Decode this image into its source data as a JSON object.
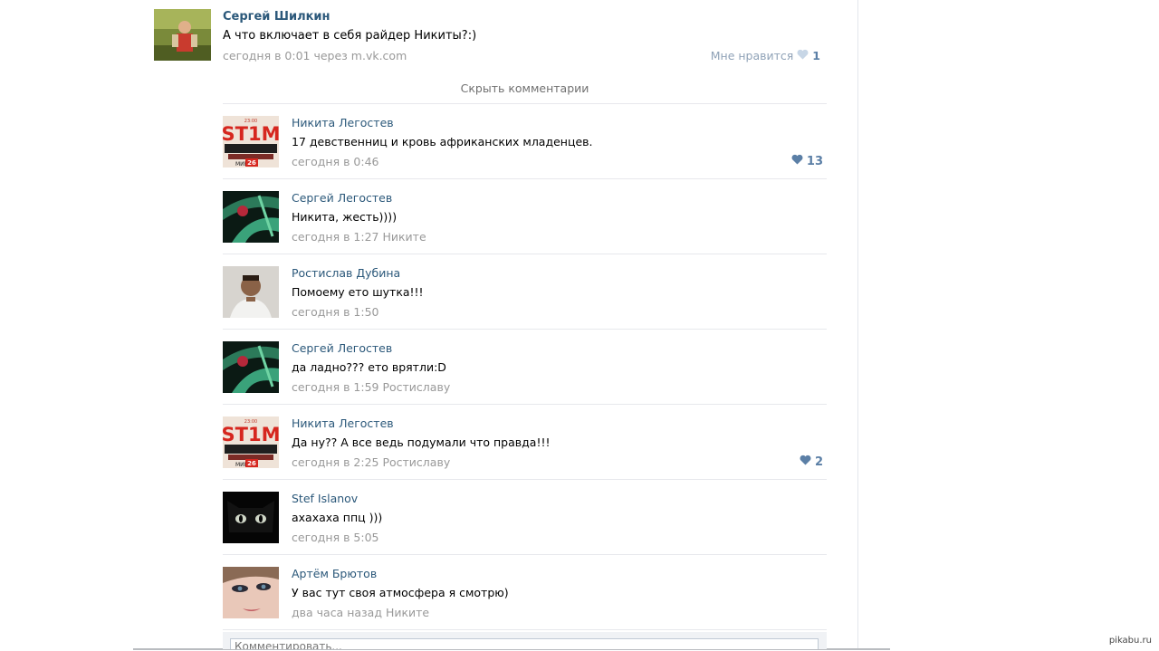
{
  "post": {
    "author": "Сергей Шилкин",
    "text": "А что включает в себя райдер Никиты?:)",
    "meta": "сегодня в 0:01 через m.vk.com",
    "like_label": "Мне нравится",
    "like_count": "1"
  },
  "hide_comments_label": "Скрыть комментарии",
  "comments": [
    {
      "name": "Никита Легостев",
      "text": "17 девственниц и кровь африканских младенцев.",
      "meta": "сегодня в 0:46",
      "likes": "13",
      "avatar": "poster"
    },
    {
      "name": "Сергей Легостев",
      "text": "Никита, жесть))))",
      "meta": "сегодня в 1:27 Никите",
      "likes": "",
      "avatar": "leaf"
    },
    {
      "name": "Ростислав Дубина",
      "text": "Помоему ето шутка!!!",
      "meta": "сегодня в 1:50",
      "likes": "",
      "avatar": "person"
    },
    {
      "name": "Сергей Легостев",
      "text": "да ладно??? ето врятли:D",
      "meta": "сегодня в 1:59 Ростиславу",
      "likes": "",
      "avatar": "leaf"
    },
    {
      "name": "Никита Легостев",
      "text": "Да ну?? А все ведь подумали что правда!!!",
      "meta": "сегодня в 2:25 Ростиславу",
      "likes": "2",
      "avatar": "poster"
    },
    {
      "name": "Stef Islanov",
      "text": "ахахаха ппц )))",
      "meta": "сегодня в 5:05",
      "likes": "",
      "avatar": "cat"
    },
    {
      "name": "Артём Брютов",
      "text": "У вас тут своя атмосфера я смотрю)",
      "meta": "два часа назад Никите",
      "likes": "",
      "avatar": "face"
    }
  ],
  "reply_placeholder": "Комментировать...",
  "poster_text": {
    "top": "ST1M",
    "mid": "МИБ",
    "num": "26",
    "small": "23:00"
  },
  "watermark": "pikabu.ru",
  "colors": {
    "link": "#2b587a",
    "meta": "#999999",
    "like": "#5b7fa6",
    "border": "#e7e8ec"
  }
}
